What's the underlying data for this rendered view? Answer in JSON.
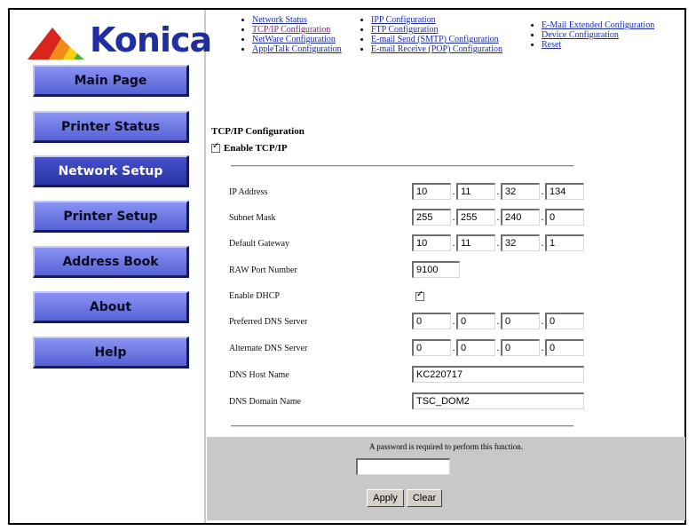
{
  "brand": {
    "name": "Konica",
    "colors": {
      "navy": "#1f2ea3",
      "red": "#d8261c",
      "orange": "#f28b16",
      "yellow": "#f5d010",
      "green": "#49b33a"
    }
  },
  "nav": [
    {
      "label": "Main Page",
      "active": false
    },
    {
      "label": "Printer Status",
      "active": false
    },
    {
      "label": "Network Setup",
      "active": true
    },
    {
      "label": "Printer Setup",
      "active": false
    },
    {
      "label": "Address Book",
      "active": false
    },
    {
      "label": "About",
      "active": false
    },
    {
      "label": "Help",
      "active": false
    }
  ],
  "links": {
    "col1": [
      "Network Status",
      "TCP/IP Configuration",
      "NetWare Configuration",
      "AppleTalk Configuration"
    ],
    "col2": [
      "IPP Configuration",
      "FTP Configuration",
      "E-mail Send (SMTP) Configuration",
      "E-mail Receive (POP) Configuration"
    ],
    "col3": [
      "E-Mail Extended Configuration",
      "Device Configuration",
      "Reset"
    ]
  },
  "section": {
    "title": "TCP/IP Configuration",
    "enable_label": "Enable TCP/IP",
    "enable_checked": true
  },
  "fields": {
    "ip_address": {
      "label": "IP Address",
      "octets": [
        "10",
        "11",
        "32",
        "134"
      ]
    },
    "subnet_mask": {
      "label": "Subnet Mask",
      "octets": [
        "255",
        "255",
        "240",
        "0"
      ]
    },
    "default_gateway": {
      "label": "Default Gateway",
      "octets": [
        "10",
        "11",
        "32",
        "1"
      ]
    },
    "raw_port": {
      "label": "RAW Port Number",
      "value": "9100"
    },
    "dhcp": {
      "label": "Enable DHCP",
      "checked": true
    },
    "preferred_dns": {
      "label": "Preferred DNS Server",
      "octets": [
        "0",
        "0",
        "0",
        "0"
      ]
    },
    "alternate_dns": {
      "label": "Alternate DNS Server",
      "octets": [
        "0",
        "0",
        "0",
        "0"
      ]
    },
    "dns_host": {
      "label": "DNS Host Name",
      "value": "KC220717"
    },
    "dns_domain": {
      "label": "DNS Domain Name",
      "value": "TSC_DOM2"
    }
  },
  "password": {
    "prompt": "A password is required to perform this function.",
    "value": ""
  },
  "buttons": {
    "apply": "Apply",
    "clear": "Clear"
  }
}
